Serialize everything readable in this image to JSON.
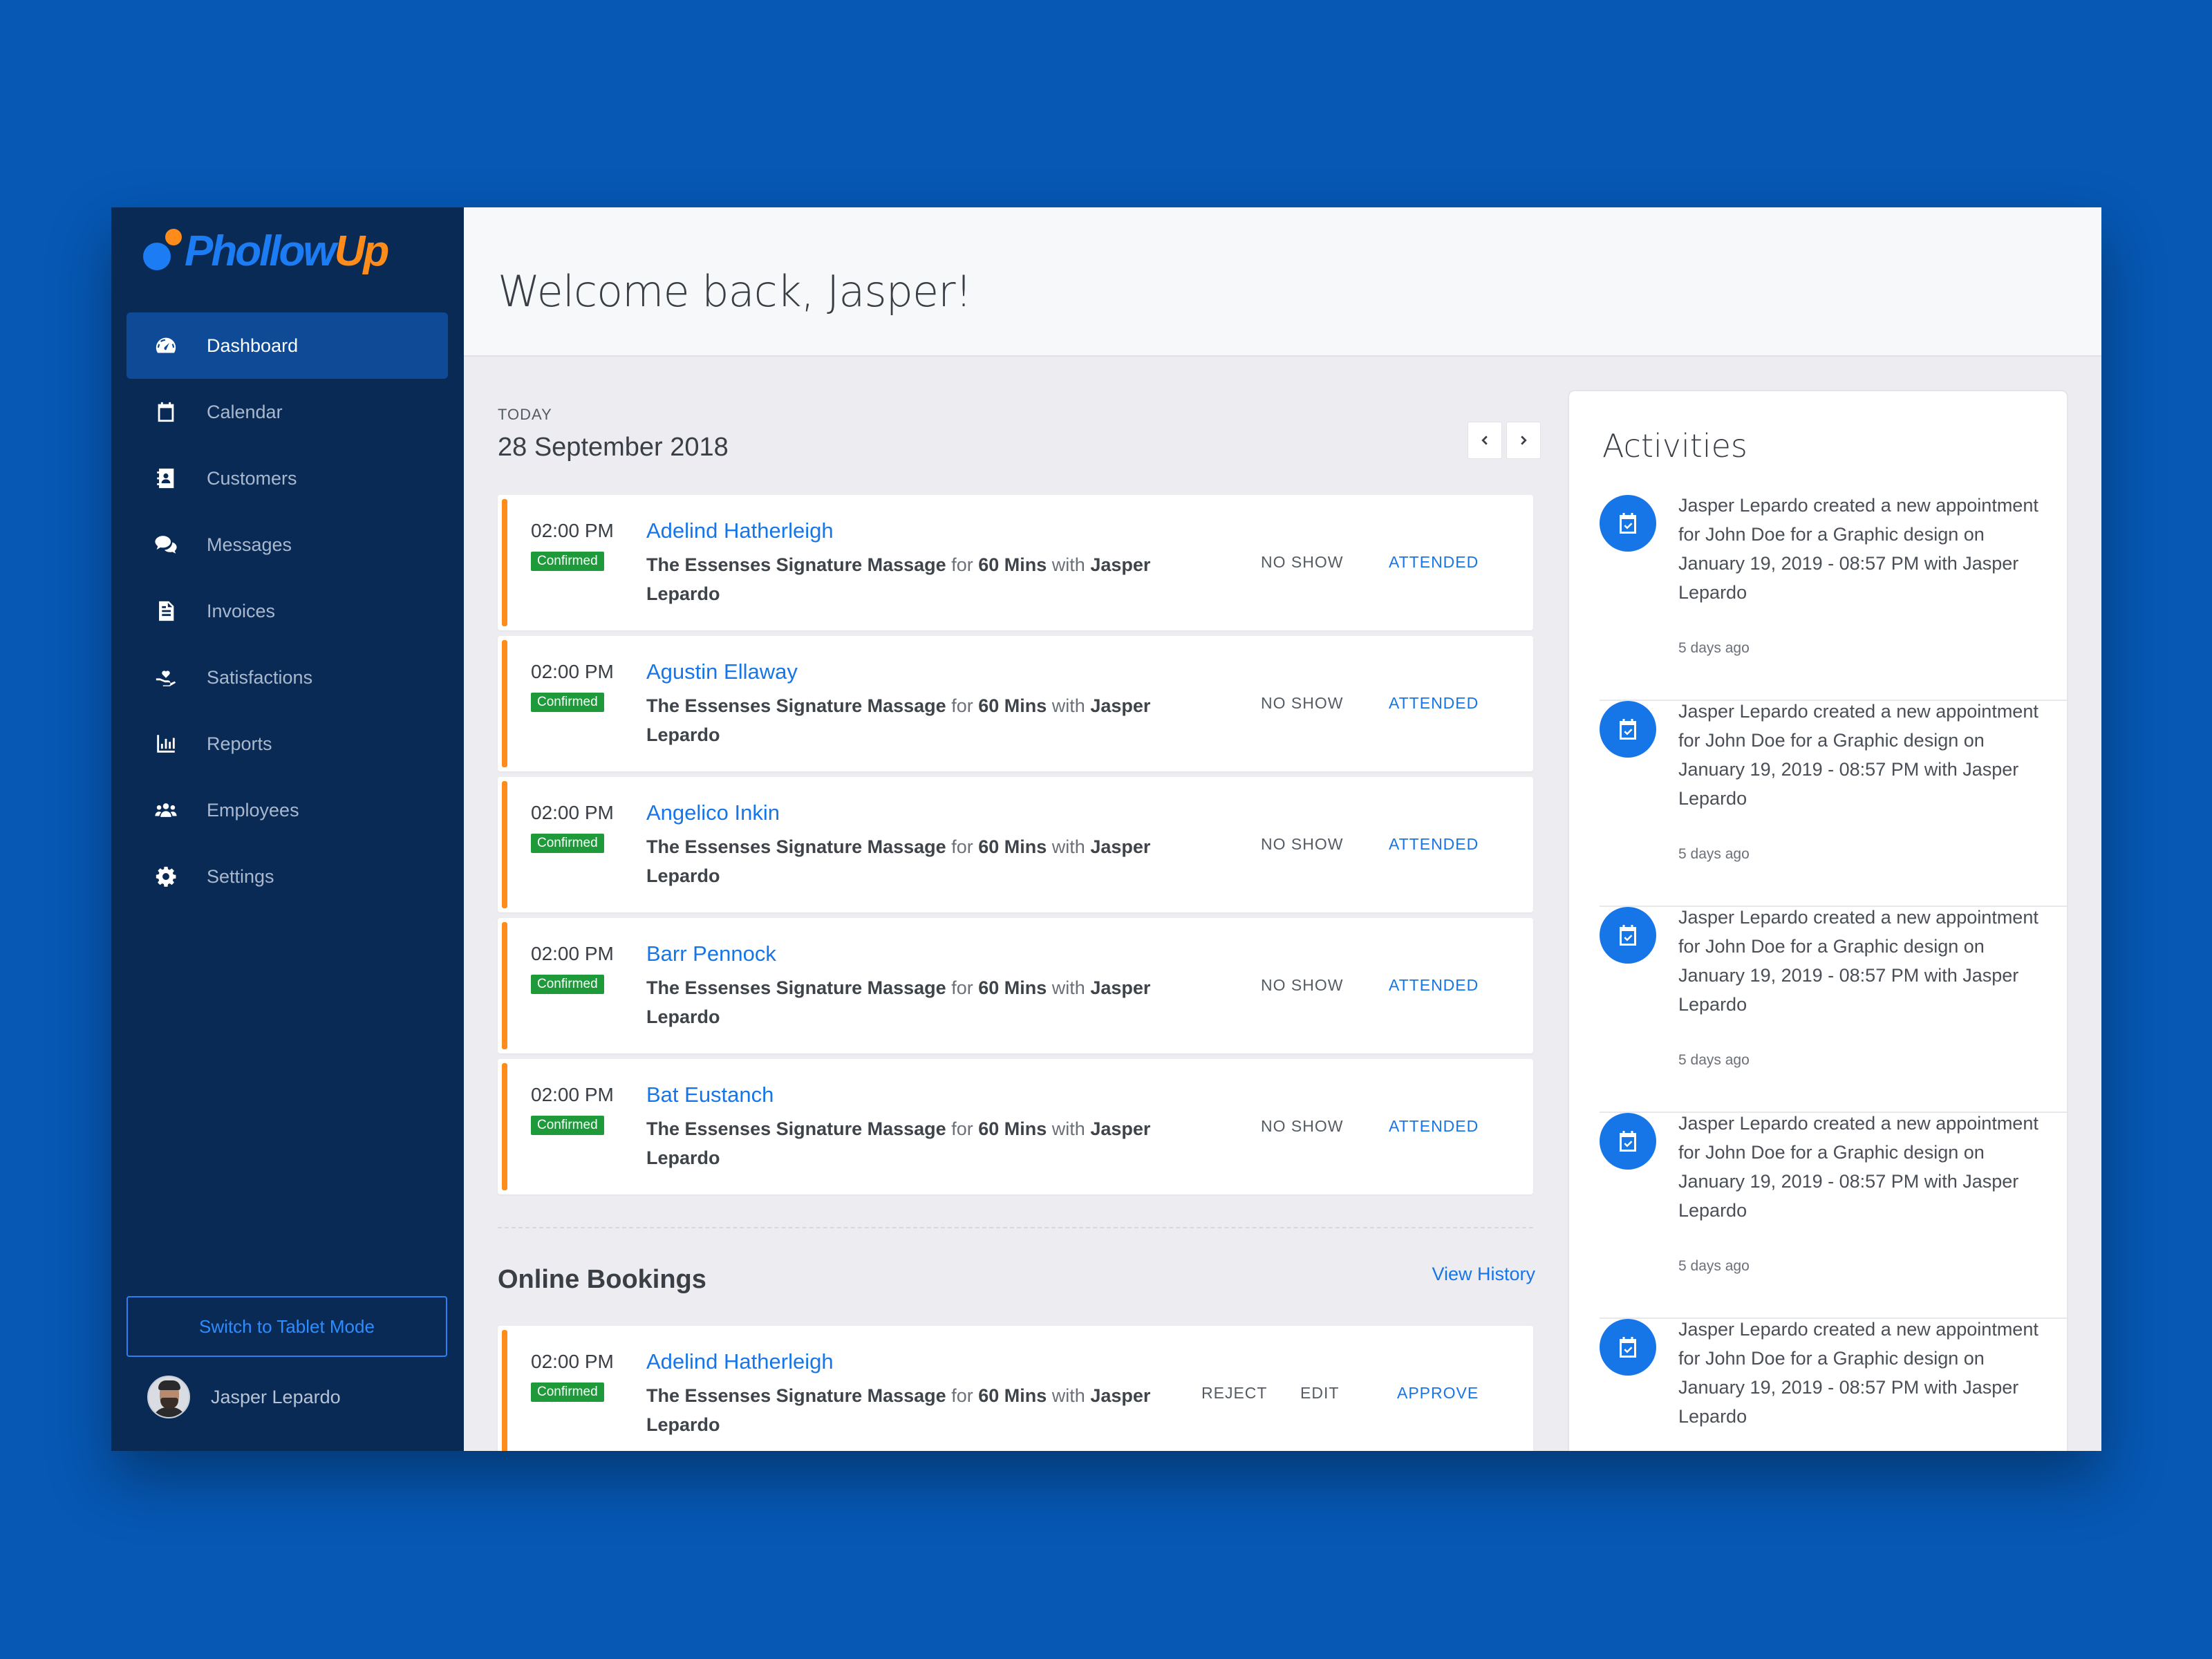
{
  "brand": {
    "name_part1": "Phollow",
    "name_part2": "Up",
    "blue": "#1c7cf4",
    "orange": "#ff8c1a"
  },
  "sidebar": {
    "items": [
      {
        "label": "Dashboard",
        "icon": "dashboard-icon",
        "active": true
      },
      {
        "label": "Calendar",
        "icon": "calendar-icon"
      },
      {
        "label": "Customers",
        "icon": "contacts-icon"
      },
      {
        "label": "Messages",
        "icon": "chat-icon"
      },
      {
        "label": "Invoices",
        "icon": "invoice-icon"
      },
      {
        "label": "Satisfactions",
        "icon": "heart-hand-icon"
      },
      {
        "label": "Reports",
        "icon": "bar-chart-icon"
      },
      {
        "label": "Employees",
        "icon": "users-icon"
      },
      {
        "label": "Settings",
        "icon": "gear-icon"
      }
    ],
    "switch_label": "Switch to Tablet Mode",
    "user_name": "Jasper Lepardo"
  },
  "header": {
    "welcome": "Welcome back, Jasper!"
  },
  "today": {
    "label": "TODAY",
    "date": "28 September 2018"
  },
  "appointments": [
    {
      "time": "02:00 PM",
      "status": "Confirmed",
      "name": "Adelind Hatherleigh",
      "service": "The Essenses Signature Massage",
      "for": "for",
      "duration": "60 Mins",
      "with": "with",
      "staff": "Jasper Lepardo",
      "no_show": "NO SHOW",
      "attended": "ATTENDED"
    },
    {
      "time": "02:00 PM",
      "status": "Confirmed",
      "name": "Agustin Ellaway",
      "service": "The Essenses Signature Massage",
      "for": "for",
      "duration": "60 Mins",
      "with": "with",
      "staff": "Jasper Lepardo",
      "no_show": "NO SHOW",
      "attended": "ATTENDED"
    },
    {
      "time": "02:00 PM",
      "status": "Confirmed",
      "name": "Angelico Inkin",
      "service": "The Essenses Signature Massage",
      "for": "for",
      "duration": "60 Mins",
      "with": "with",
      "staff": "Jasper Lepardo",
      "no_show": "NO SHOW",
      "attended": "ATTENDED"
    },
    {
      "time": "02:00 PM",
      "status": "Confirmed",
      "name": "Barr Pennock",
      "service": "The Essenses Signature Massage",
      "for": "for",
      "duration": "60 Mins",
      "with": "with",
      "staff": "Jasper Lepardo",
      "no_show": "NO SHOW",
      "attended": "ATTENDED"
    },
    {
      "time": "02:00 PM",
      "status": "Confirmed",
      "name": "Bat Eustanch",
      "service": "The Essenses Signature Massage",
      "for": "for",
      "duration": "60 Mins",
      "with": "with",
      "staff": "Jasper Lepardo",
      "no_show": "NO SHOW",
      "attended": "ATTENDED"
    }
  ],
  "online_bookings": {
    "title": "Online Bookings",
    "view_history": "View History",
    "items": [
      {
        "time": "02:00 PM",
        "status": "Confirmed",
        "name": "Adelind Hatherleigh",
        "service": "The Essenses Signature Massage",
        "for": "for",
        "duration": "60 Mins",
        "with": "with",
        "staff": "Jasper Lepardo",
        "reject": "REJECT",
        "edit": "EDIT",
        "approve": "APPROVE"
      }
    ]
  },
  "activities": {
    "title": "Activities",
    "items": [
      {
        "text": "Jasper Lepardo created a new appointment for John Doe for a Graphic design on January 19, 2019 - 08:57 PM with Jasper Lepardo",
        "time": "5 days ago"
      },
      {
        "text": "Jasper Lepardo created a new appointment for John Doe for a Graphic design on January 19, 2019 - 08:57 PM with Jasper Lepardo",
        "time": "5 days ago"
      },
      {
        "text": "Jasper Lepardo created a new appointment for John Doe for a Graphic design on January 19, 2019 - 08:57 PM with Jasper Lepardo",
        "time": "5 days ago"
      },
      {
        "text": "Jasper Lepardo created a new appointment for John Doe for a Graphic design on January 19, 2019 - 08:57 PM with Jasper Lepardo",
        "time": "5 days ago"
      },
      {
        "text": "Jasper Lepardo created a new appointment for John Doe for a Graphic design on January 19, 2019 - 08:57 PM with Jasper Lepardo"
      }
    ]
  },
  "colors": {
    "page_bg": "#0658b4",
    "sidebar_bg": "#0a2a56",
    "accent_blue": "#1676e8",
    "stripe_orange": "#ff8c1a",
    "badge_green": "#1e9a3b"
  }
}
